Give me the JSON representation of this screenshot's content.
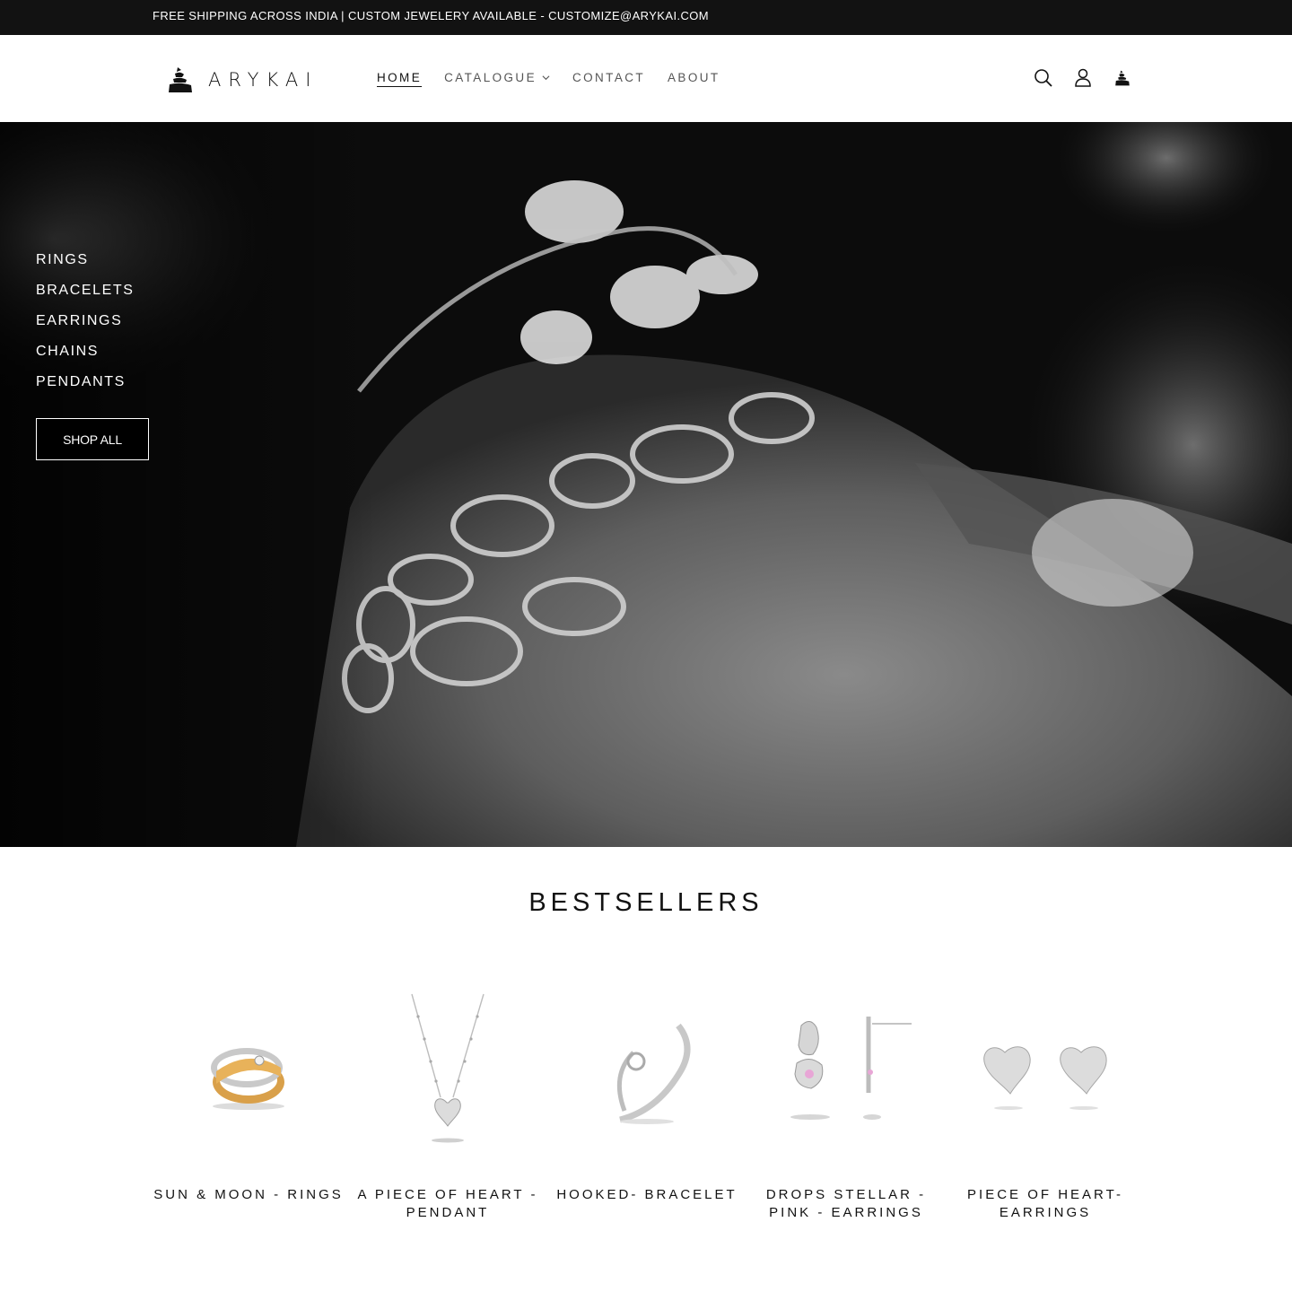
{
  "announcement": {
    "text": "FREE SHIPPING ACROSS INDIA | CUSTOM JEWELERY AVAILABLE - CUSTOMIZE@ARYKAI.COM"
  },
  "header": {
    "logo_text": "ARYKAI",
    "nav": [
      {
        "label": "HOME",
        "active": true
      },
      {
        "label": "CATALOGUE",
        "has_dropdown": true
      },
      {
        "label": "CONTACT"
      },
      {
        "label": "ABOUT"
      }
    ],
    "icons": [
      "search-icon",
      "account-icon",
      "cart-icon"
    ]
  },
  "hero": {
    "links": [
      "RINGS",
      "BRACELETS",
      "EARRINGS",
      "CHAINS",
      "PENDANTS"
    ],
    "cta_label": "SHOP ALL"
  },
  "bestsellers": {
    "title": "BESTSELLERS",
    "products": [
      {
        "name": "SUN & MOON - RINGS"
      },
      {
        "name": "A PIECE OF HEART - PENDANT"
      },
      {
        "name": "HOOKED- BRACELET"
      },
      {
        "name": "DROPS STELLAR - PINK - EARRINGS"
      },
      {
        "name": "PIECE OF HEART- EARRINGS"
      }
    ]
  },
  "colors": {
    "bar": "#121212",
    "text": "#121212",
    "muted_nav": "#555555",
    "background": "#ffffff"
  }
}
